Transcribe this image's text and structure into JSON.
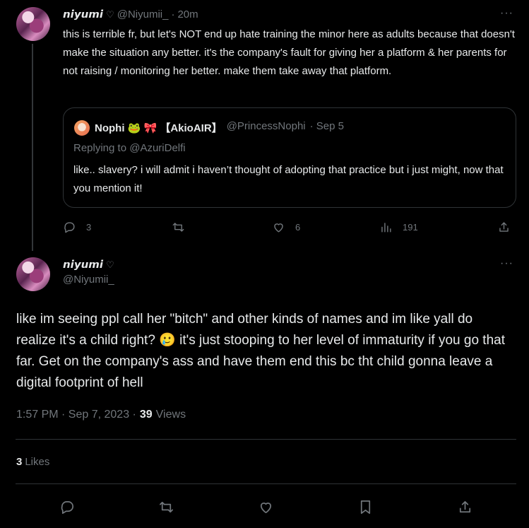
{
  "tweet1": {
    "display_name": "𝙣𝙞𝙮𝙪𝙢𝙞",
    "name_heart": "♡",
    "handle": "@Niyumii_",
    "sep": "·",
    "time": "20m",
    "text": "this is terrible fr, but let's NOT end up hate training the minor here as adults because that doesn't make the situation any better. it's the company's fault for giving her a platform & her parents for not raising / monitoring her better. make them take away that platform.",
    "quote": {
      "display_name": "Nophi 🐸 🎀 【AkioAIR】",
      "handle": "@PrincessNophi",
      "date": "· Sep 5",
      "replying_to": "Replying to @AzuriDelfi",
      "text": "like.. slavery? i will admit i haven’t thought of adopting that practice but i just might, now that you mention it!"
    },
    "replies": "3",
    "likes": "6",
    "views": "191"
  },
  "tweet2": {
    "display_name": "𝙣𝙞𝙮𝙪𝙢𝙞",
    "name_heart": "♡",
    "handle": "@Niyumii_",
    "text": "like im seeing ppl call her \"bitch\" and other kinds of names and im like yall do realize it's a child right? 🥲 it's just stooping to her level of immaturity if you go that far. Get on the company's ass and have them end this bc tht child gonna leave a digital footprint of hell",
    "timestamp": "1:57 PM · Sep 7, 2023 ·",
    "views_count": "39",
    "views_label": "Views",
    "likes_count": "3",
    "likes_label": "Likes"
  },
  "more_glyph": "···",
  "icons": [
    "reply-icon",
    "retweet-icon",
    "like-icon",
    "views-icon",
    "share-icon",
    "bookmark-icon",
    "more-icon"
  ],
  "colors": {
    "background": "#000000",
    "text": "#e7e9ea",
    "secondary": "#71767b",
    "border": "#2f3336"
  }
}
